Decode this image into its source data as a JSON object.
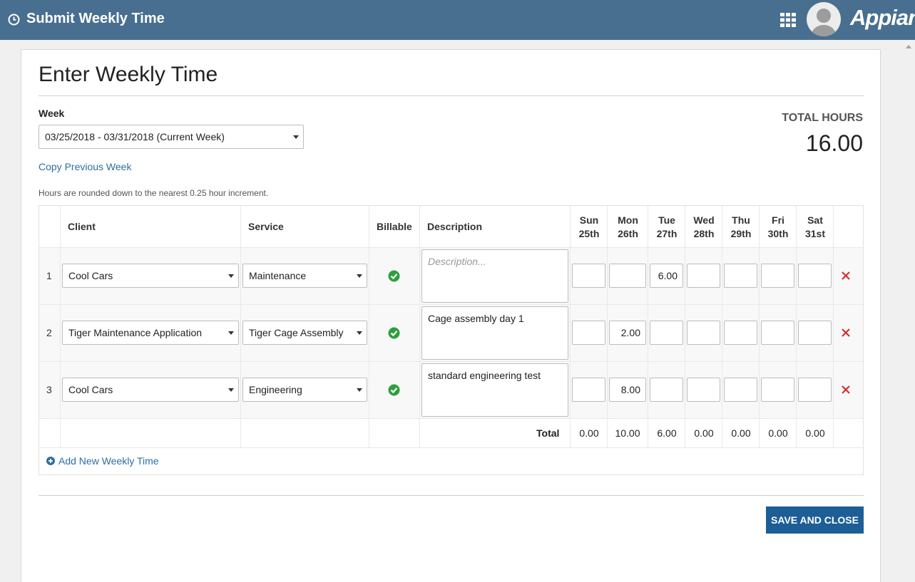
{
  "header": {
    "title": "Submit Weekly Time",
    "brand": "Appian"
  },
  "page": {
    "title": "Enter Weekly Time"
  },
  "week": {
    "label": "Week",
    "selected": "03/25/2018 - 03/31/2018 (Current Week)"
  },
  "copy_link": "Copy Previous Week",
  "total": {
    "label": "TOTAL HOURS",
    "value": "16.00"
  },
  "hint": "Hours are rounded down to the nearest 0.25 hour increment.",
  "table": {
    "headers": {
      "client": "Client",
      "service": "Service",
      "billable": "Billable",
      "description": "Description"
    },
    "days": [
      {
        "name": "Sun",
        "date": "25th"
      },
      {
        "name": "Mon",
        "date": "26th"
      },
      {
        "name": "Tue",
        "date": "27th"
      },
      {
        "name": "Wed",
        "date": "28th"
      },
      {
        "name": "Thu",
        "date": "29th"
      },
      {
        "name": "Fri",
        "date": "30th"
      },
      {
        "name": "Sat",
        "date": "31st"
      }
    ],
    "rows": [
      {
        "num": "1",
        "client": "Cool Cars",
        "service": "Maintenance",
        "description": "",
        "description_placeholder": "Description...",
        "hours": [
          "",
          "",
          "6.00",
          "",
          "",
          "",
          ""
        ]
      },
      {
        "num": "2",
        "client": "Tiger Maintenance Application",
        "service": "Tiger Cage Assembly",
        "description": "Cage assembly day 1",
        "description_placeholder": "",
        "hours": [
          "",
          "2.00",
          "",
          "",
          "",
          "",
          ""
        ]
      },
      {
        "num": "3",
        "client": "Cool Cars",
        "service": "Engineering",
        "description": "standard engineering test",
        "description_placeholder": "",
        "hours": [
          "",
          "8.00",
          "",
          "",
          "",
          "",
          ""
        ]
      }
    ],
    "totals_label": "Total",
    "totals": [
      "0.00",
      "10.00",
      "6.00",
      "0.00",
      "0.00",
      "0.00",
      "0.00"
    ]
  },
  "add_link": "Add New Weekly Time",
  "save_button": "SAVE AND CLOSE",
  "colors": {
    "header_bg": "#486f8f",
    "link": "#2f6ea3",
    "primary_button": "#1d5e96",
    "check": "#2e9e3e",
    "delete": "#d32f2f"
  }
}
